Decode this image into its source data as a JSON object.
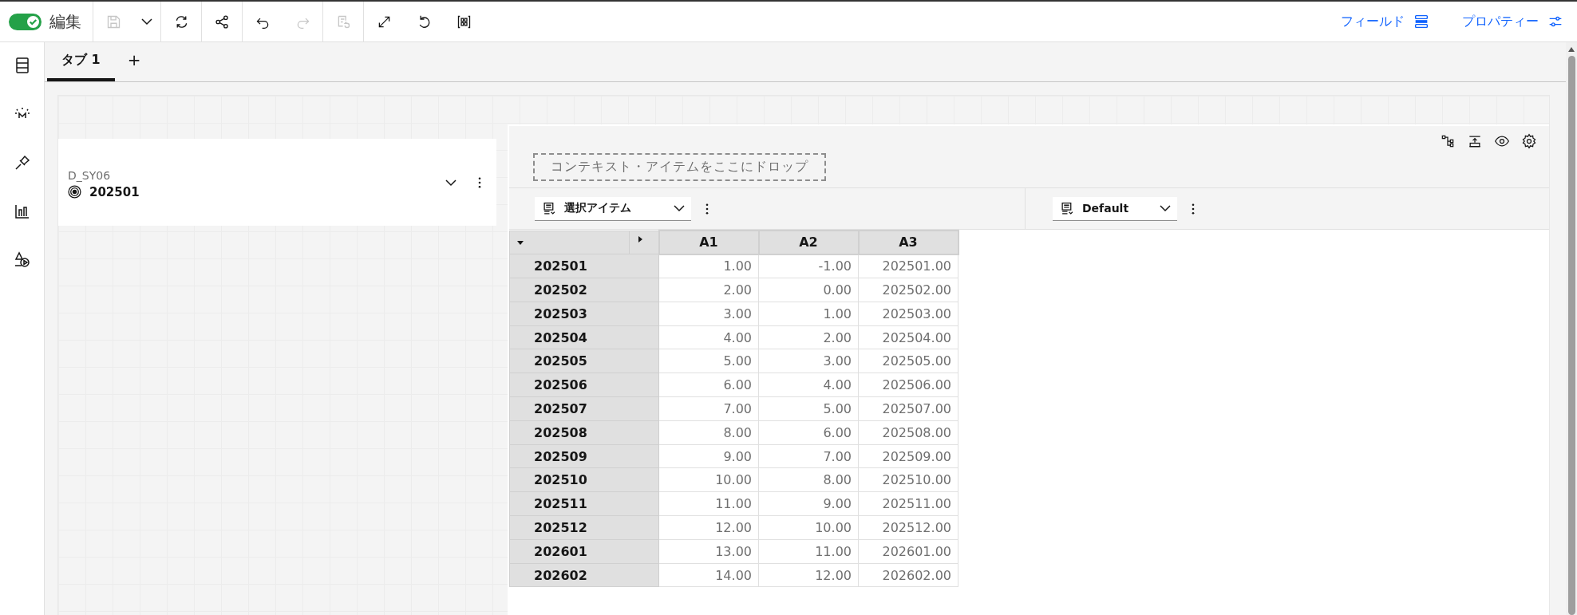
{
  "toolbar": {
    "edit_toggle": {
      "label": "編集",
      "on": true
    },
    "tool_groups": [
      [
        {
          "kind": "save",
          "disabled": true
        },
        {
          "kind": "caret",
          "disabled": false
        }
      ],
      [
        {
          "kind": "refresh",
          "disabled": false
        }
      ],
      [
        {
          "kind": "share",
          "disabled": false
        }
      ],
      [
        {
          "kind": "undo",
          "disabled": false
        },
        {
          "kind": "redo",
          "disabled": true
        }
      ],
      [
        {
          "kind": "revert",
          "disabled": true
        }
      ],
      [
        {
          "kind": "expand",
          "disabled": false
        },
        {
          "kind": "reset",
          "disabled": false
        },
        {
          "kind": "grid",
          "disabled": false
        }
      ]
    ],
    "links": [
      {
        "label": "フィールド",
        "kind": "fields"
      },
      {
        "label": "プロパティー",
        "kind": "properties"
      }
    ]
  },
  "side_rail": [
    {
      "kind": "data"
    },
    {
      "kind": "insight"
    },
    {
      "kind": "pin"
    },
    {
      "kind": "chart"
    },
    {
      "kind": "shapes"
    }
  ],
  "tabs": [
    {
      "label": "タブ 1",
      "selected": true
    }
  ],
  "add_tab": "+",
  "filter_card": {
    "label": "D_SY06",
    "value": "202501"
  },
  "pivot": {
    "drop_zone": "コンテキスト・アイテムをここにドロップ",
    "row_selector": "選択アイテム",
    "column_selector": "Default",
    "columns": [
      "A1",
      "A2",
      "A3"
    ],
    "rows": [
      {
        "label": "202501",
        "cells": [
          "1.00",
          "-1.00",
          "202501.00"
        ]
      },
      {
        "label": "202502",
        "cells": [
          "2.00",
          "0.00",
          "202502.00"
        ]
      },
      {
        "label": "202503",
        "cells": [
          "3.00",
          "1.00",
          "202503.00"
        ]
      },
      {
        "label": "202504",
        "cells": [
          "4.00",
          "2.00",
          "202504.00"
        ]
      },
      {
        "label": "202505",
        "cells": [
          "5.00",
          "3.00",
          "202505.00"
        ]
      },
      {
        "label": "202506",
        "cells": [
          "6.00",
          "4.00",
          "202506.00"
        ]
      },
      {
        "label": "202507",
        "cells": [
          "7.00",
          "5.00",
          "202507.00"
        ]
      },
      {
        "label": "202508",
        "cells": [
          "8.00",
          "6.00",
          "202508.00"
        ]
      },
      {
        "label": "202509",
        "cells": [
          "9.00",
          "7.00",
          "202509.00"
        ]
      },
      {
        "label": "202510",
        "cells": [
          "10.00",
          "8.00",
          "202510.00"
        ]
      },
      {
        "label": "202511",
        "cells": [
          "11.00",
          "9.00",
          "202511.00"
        ]
      },
      {
        "label": "202512",
        "cells": [
          "12.00",
          "10.00",
          "202512.00"
        ]
      },
      {
        "label": "202601",
        "cells": [
          "13.00",
          "11.00",
          "202601.00"
        ]
      },
      {
        "label": "202602",
        "cells": [
          "14.00",
          "12.00",
          "202602.00"
        ]
      }
    ]
  }
}
